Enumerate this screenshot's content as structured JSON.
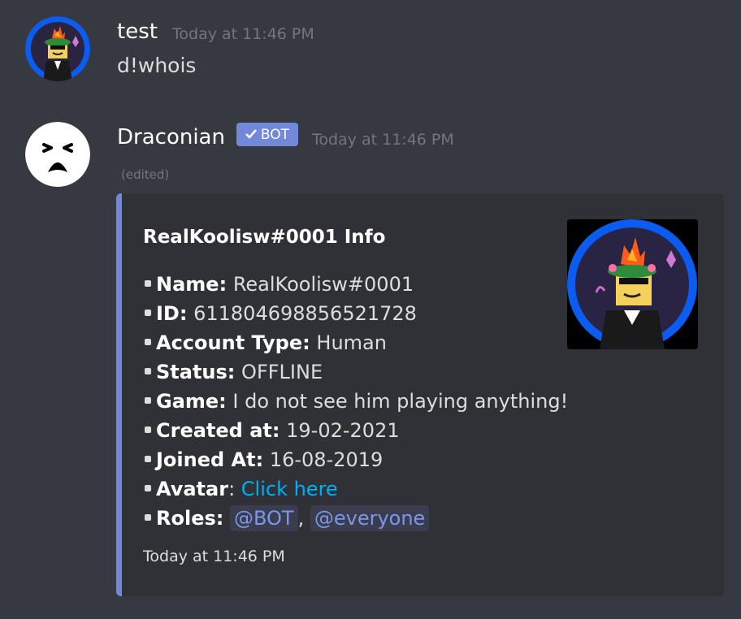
{
  "messages": [
    {
      "username": "test",
      "timestamp": "Today at 11:46 PM",
      "content": "d!whois"
    },
    {
      "username": "Draconian",
      "badge": "BOT",
      "timestamp": "Today at 11:46 PM",
      "edited": "(edited)",
      "embed": {
        "title": "RealKoolisw#0001 Info",
        "fields": [
          {
            "label": "Name:",
            "value": "RealKoolisw#0001"
          },
          {
            "label": "ID:",
            "value": "611804698856521728"
          },
          {
            "label": "Account Type:",
            "value": "Human"
          },
          {
            "label": "Status:",
            "value": "OFFLINE"
          },
          {
            "label": "Game:",
            "value": "I do not see him playing anything!"
          },
          {
            "label": "Created at:",
            "value": "19-02-2021"
          },
          {
            "label": "Joined At:",
            "value": "16-08-2019"
          }
        ],
        "avatar_label": "Avatar",
        "avatar_link": "Click here",
        "roles_label": "Roles:",
        "roles": [
          "@BOT",
          "@everyone"
        ],
        "footer": "Today at 11:46 PM"
      }
    }
  ],
  "colors": {
    "background": "#36393f",
    "embed_bg": "#2f3136",
    "embed_border": "#7289da",
    "bot_badge": "#7289da",
    "link": "#00b0f4"
  },
  "icons": {
    "check": "checkmark-icon",
    "test_avatar": "roblox-avatar-icon",
    "draconian_avatar": "crying-face-icon",
    "thumbnail": "roblox-avatar-thumbnail"
  }
}
